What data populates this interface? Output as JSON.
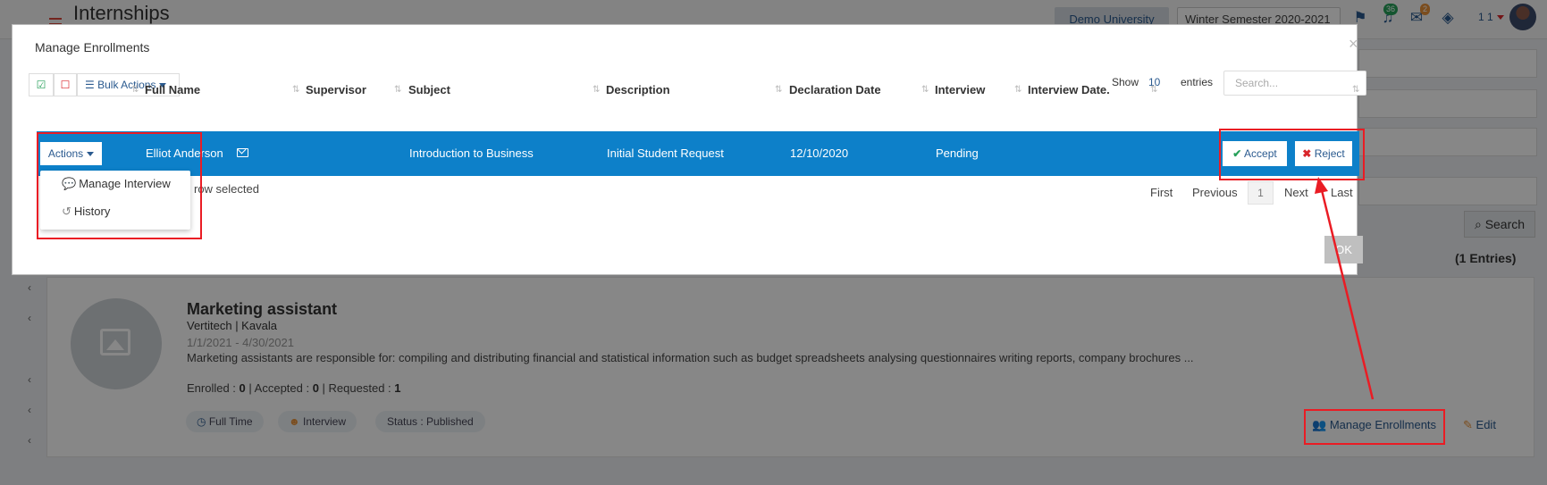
{
  "app": {
    "page_title": "Internships",
    "university": "Demo University",
    "semester": "Winter Semester 2020-2021",
    "notifications_count": "36",
    "messages_count": "2",
    "user_count": "1 1"
  },
  "icons": {
    "flag": "flag-icon",
    "bell": "bell-icon",
    "mail": "envelope-icon",
    "layers": "layers-icon",
    "menu": "hamburger-menu-icon"
  },
  "background": {
    "search_button": "Search",
    "entries_total": "(1 Entries)",
    "card": {
      "title": "Marketing assistant",
      "company": "Vertitech | Kavala",
      "dates": "1/1/2021 - 4/30/2021",
      "description": "Marketing assistants are responsible for: compiling and distributing financial and statistical information such as budget spreadsheets analysing questionnaires writing reports, company brochures ...",
      "stats": {
        "enrolled_label": "Enrolled : ",
        "enrolled": "0",
        "accepted_label": " | Accepted : ",
        "accepted": "0",
        "requested_label": " | Requested : ",
        "requested": "1"
      },
      "tags": [
        "Full Time",
        "Interview",
        "Status : Published"
      ],
      "manage_link": "Manage Enrollments",
      "edit_link": "Edit"
    }
  },
  "modal": {
    "title": "Manage Enrollments",
    "bulk_actions": "Bulk Actions",
    "show_label": "Show",
    "show_value": "10",
    "entries_label": "entries",
    "search_placeholder": "Search...",
    "columns": [
      "Full Name",
      "Supervisor",
      "Subject",
      "Description",
      "Declaration Date",
      "Interview",
      "Interview Date."
    ],
    "row": {
      "actions": "Actions",
      "full_name": "Elliot Anderson",
      "supervisor": "",
      "subject": "Introduction to Business",
      "description": "Initial Student Request",
      "declaration_date": "12/10/2020",
      "interview": "Pending",
      "interview_date": "",
      "accept": "Accept",
      "reject": "Reject"
    },
    "actions_menu": [
      "Manage Interview",
      "History"
    ],
    "selection_info": "row selected",
    "pager": {
      "first": "First",
      "previous": "Previous",
      "current": "1",
      "next": "Next",
      "last": "Last"
    },
    "ok": "OK"
  },
  "colors": {
    "selected_row": "#0d80c9",
    "link": "#2a5a8f",
    "annotation": "#ea1c24",
    "accept": "#27a05a",
    "reject": "#d9262b"
  }
}
